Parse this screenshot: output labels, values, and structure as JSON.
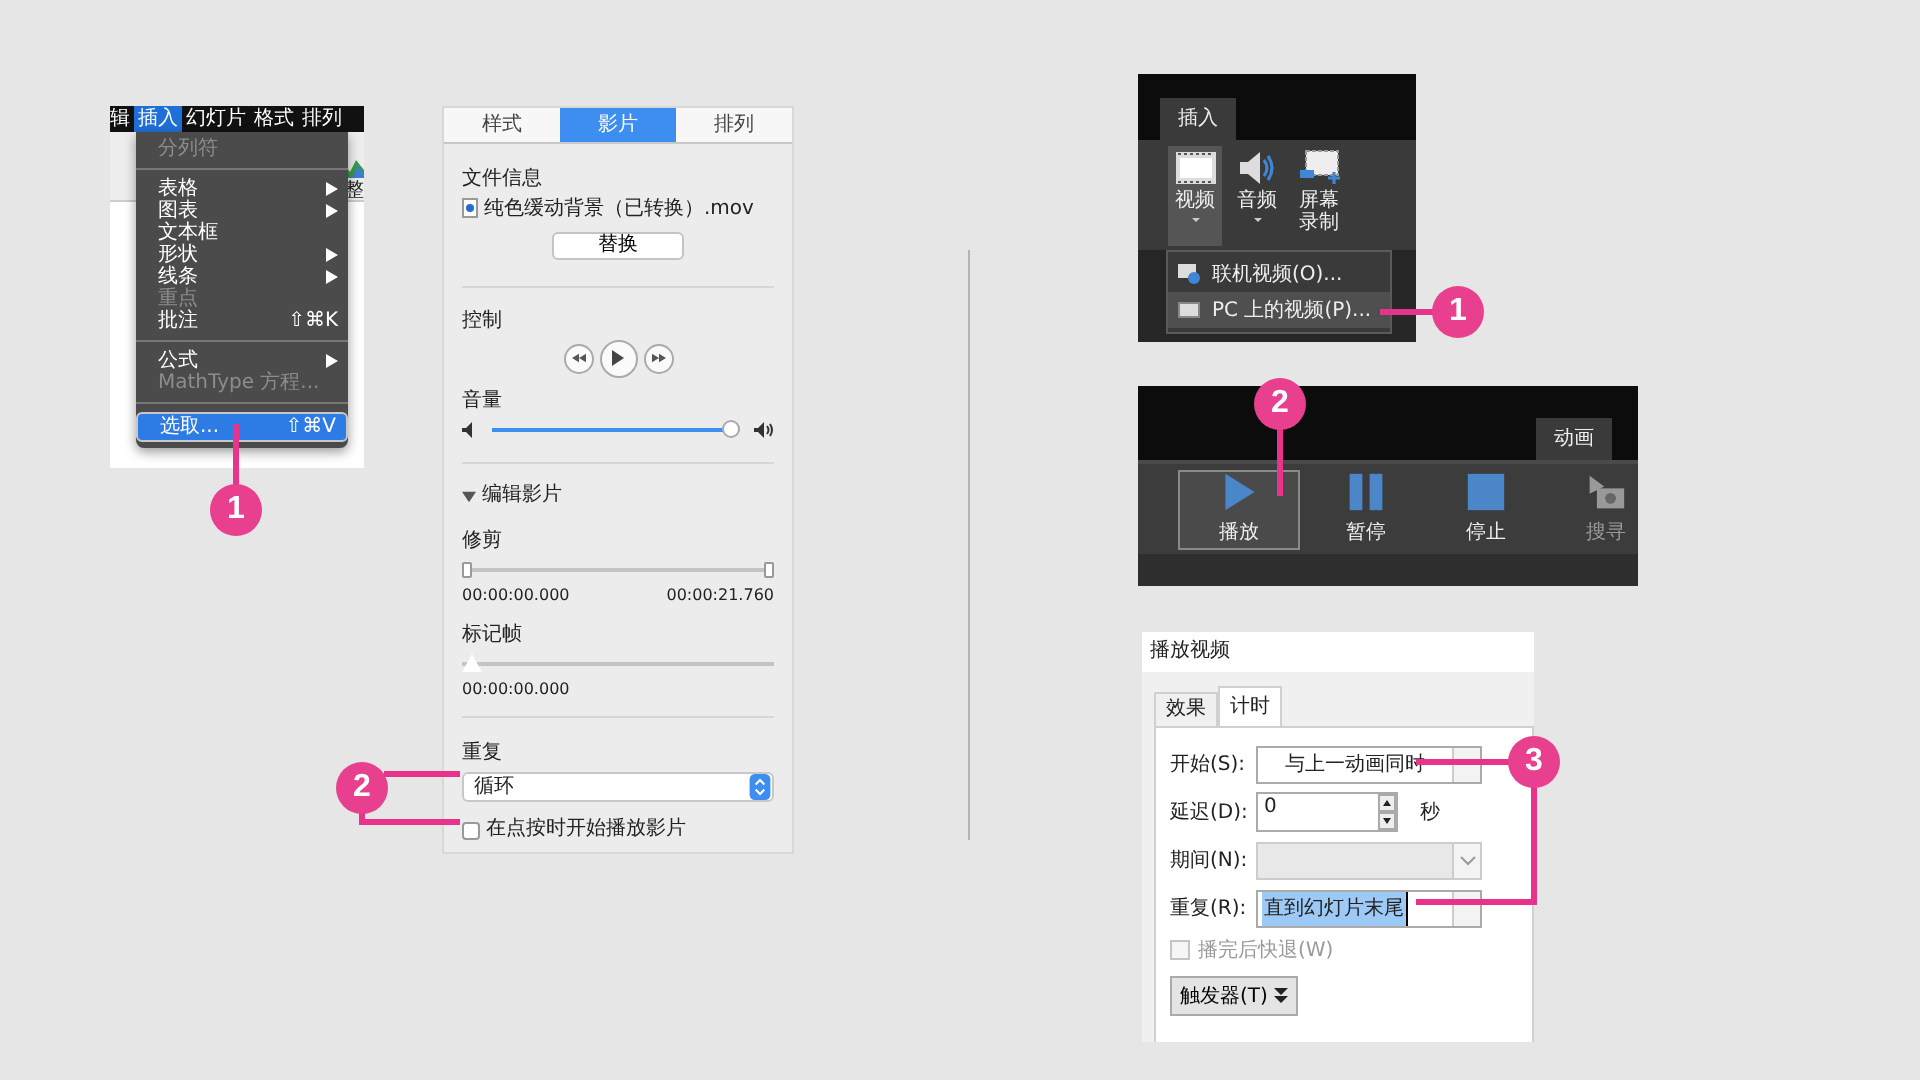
{
  "mac_menu": {
    "menubar": [
      {
        "label": "辑",
        "selected": false
      },
      {
        "label": "插入",
        "selected": true
      },
      {
        "label": "幻灯片",
        "selected": false
      },
      {
        "label": "格式",
        "selected": false
      },
      {
        "label": "排列",
        "selected": false
      }
    ],
    "ribbon_label": "整",
    "items": [
      {
        "kind": "item",
        "label": "分列符",
        "disabled": true,
        "submenu": false,
        "selected": false
      },
      {
        "kind": "separator"
      },
      {
        "kind": "item",
        "label": "表格",
        "disabled": false,
        "submenu": true,
        "selected": false
      },
      {
        "kind": "item",
        "label": "图表",
        "disabled": false,
        "submenu": true,
        "selected": false
      },
      {
        "kind": "item",
        "label": "文本框",
        "disabled": false,
        "submenu": false,
        "selected": false
      },
      {
        "kind": "item",
        "label": "形状",
        "disabled": false,
        "submenu": true,
        "selected": false
      },
      {
        "kind": "item",
        "label": "线条",
        "disabled": false,
        "submenu": true,
        "selected": false
      },
      {
        "kind": "item",
        "label": "重点",
        "disabled": true,
        "submenu": false,
        "selected": false
      },
      {
        "kind": "item",
        "label": "批注",
        "shortcut": "⇧⌘K",
        "disabled": false,
        "submenu": false,
        "selected": false
      },
      {
        "kind": "separator"
      },
      {
        "kind": "item",
        "label": "公式",
        "disabled": false,
        "submenu": true,
        "selected": false
      },
      {
        "kind": "item",
        "label": "MathType 方程...",
        "disabled": true,
        "submenu": false,
        "selected": false
      },
      {
        "kind": "separator"
      },
      {
        "kind": "item",
        "label": "选取...",
        "shortcut": "⇧⌘V",
        "disabled": false,
        "submenu": false,
        "selected": true
      }
    ],
    "callout": "1"
  },
  "movie_panel": {
    "tabs": [
      {
        "label": "样式",
        "selected": false
      },
      {
        "label": "影片",
        "selected": true
      },
      {
        "label": "排列",
        "selected": false
      }
    ],
    "file_info": {
      "heading": "文件信息",
      "file_name": "纯色缓动背景（已转换）.mov",
      "replace_button": "替换"
    },
    "controls": {
      "heading": "控制"
    },
    "volume": {
      "heading": "音量",
      "level": 0.97
    },
    "edit_movie": {
      "heading": "编辑影片",
      "expanded": true,
      "trim": {
        "heading": "修剪",
        "start": "00:00:00.000",
        "end": "00:00:21.760",
        "handles": [
          {
            "level": 0
          },
          {
            "level": 1
          }
        ]
      },
      "poster_frame": {
        "heading": "标记帧",
        "level": 0,
        "time": "00:00:00.000"
      }
    },
    "repeat": {
      "heading": "重复",
      "value": "循环"
    },
    "play_on_click": {
      "label": "在点按时开始播放影片",
      "checked": false
    },
    "callout": "2"
  },
  "insert_ribbon": {
    "tab": "插入",
    "buttons": [
      {
        "kind": "video",
        "label": "视频",
        "dropdown": true,
        "selected": true
      },
      {
        "kind": "audio",
        "label": "音频",
        "dropdown": true,
        "selected": false
      },
      {
        "kind": "screen_recording",
        "label": "屏幕录制",
        "dropdown": false,
        "selected": false
      }
    ],
    "menu": [
      {
        "kind": "online",
        "label": "联机视频(O)...",
        "selected": false
      },
      {
        "kind": "pc",
        "label": "PC 上的视频(P)...",
        "selected": true
      }
    ],
    "callout": "1"
  },
  "animation_ribbon": {
    "tab": "动画",
    "buttons": [
      {
        "kind": "play",
        "label": "播放",
        "selected": true,
        "disabled": false
      },
      {
        "kind": "pause",
        "label": "暂停",
        "selected": false,
        "disabled": false
      },
      {
        "kind": "stop",
        "label": "停止",
        "selected": false,
        "disabled": false
      },
      {
        "kind": "seek",
        "label": "搜寻",
        "selected": false,
        "disabled": true
      }
    ],
    "callout": "2"
  },
  "dialog": {
    "title": "播放视频",
    "tabs": [
      {
        "label": "效果",
        "selected": false
      },
      {
        "label": "计时",
        "selected": true
      }
    ],
    "fields": [
      {
        "kind": "combo",
        "label": "开始(S):",
        "value": "与上一动画同时",
        "disabled": false
      },
      {
        "kind": "spinner",
        "label": "延迟(D):",
        "value": "0",
        "unit": "秒"
      },
      {
        "kind": "combo",
        "label": "期间(N):",
        "disabled": true
      },
      {
        "kind": "combo",
        "label": "重复(R):",
        "value": "直到幻灯片末尾",
        "disabled": false,
        "highlighted": true
      }
    ],
    "rewind": {
      "label": "播完后快退(W)",
      "checked": false,
      "disabled": true
    },
    "trigger_button": "触发器(T)",
    "callout": "3"
  }
}
